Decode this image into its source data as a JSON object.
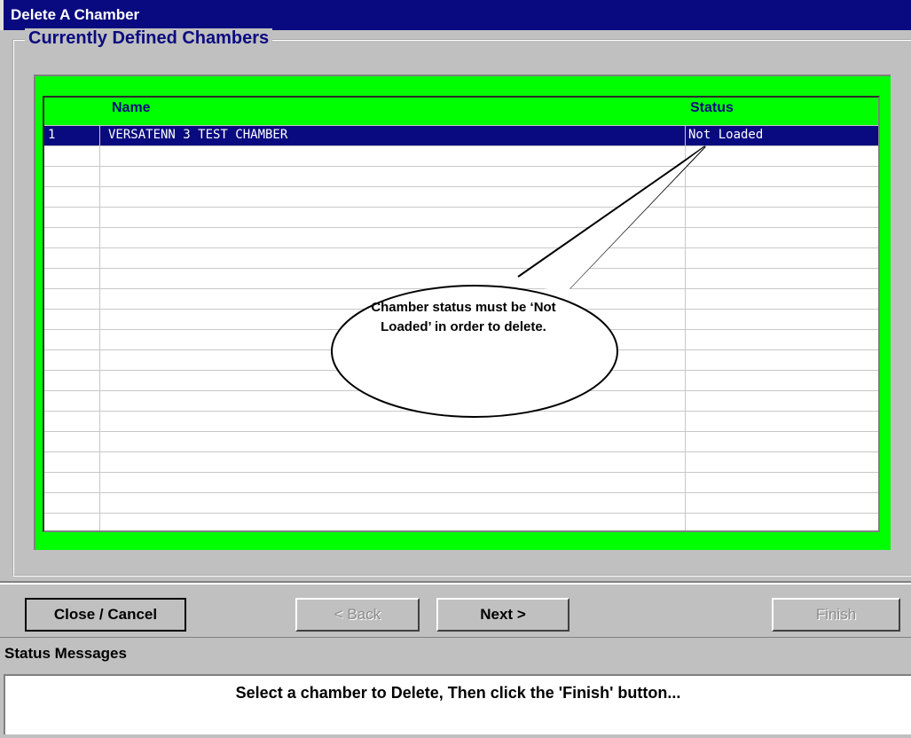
{
  "window": {
    "title": "Delete A Chamber"
  },
  "chambers_group": {
    "label": "Currently Defined Chambers"
  },
  "grid": {
    "columns": [
      "Name",
      "Status"
    ],
    "rows": [
      {
        "index": "1",
        "name": "VERSATENN 3 TEST CHAMBER",
        "status": "Not Loaded",
        "selected": true
      }
    ]
  },
  "callout": {
    "text": "Chamber status must be ‘Not Loaded’ in order to delete."
  },
  "buttons": {
    "close_cancel": "Close / Cancel",
    "back": "< Back",
    "next": "Next >",
    "finish": "Finish"
  },
  "status": {
    "header": "Status Messages",
    "message": "Select a chamber to Delete, Then click the 'Finish' button..."
  },
  "colors": {
    "title_bar": "#0a0a80",
    "grid_frame": "#00ff00",
    "selection": "#0a0a80",
    "window_bg": "#c0c0c0"
  }
}
